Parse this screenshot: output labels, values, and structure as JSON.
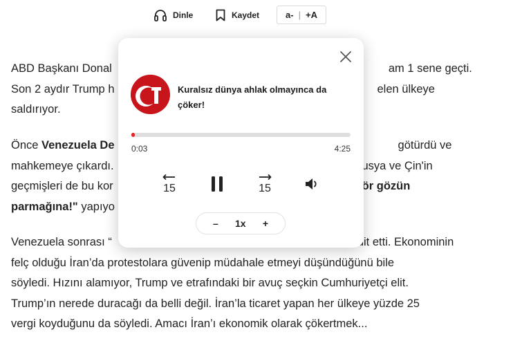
{
  "toolbar": {
    "listen_label": "Dinle",
    "save_label": "Kaydet",
    "font_decrease": "a-",
    "font_separator": "|",
    "font_increase": "+A"
  },
  "article": {
    "p1": {
      "l1_a": "ABD Başkanı Donal",
      "l1_b": "am 1 sene geçti.",
      "l2_a": "Son 2 aydır Trump h",
      "l2_b": "elen ülkeye",
      "l3": "saldırıyor."
    },
    "p2": {
      "l1_a": "Önce ",
      "l1_bold": "Venezuela De",
      "l1_b": "götürdü ve",
      "l2_a": "mahkemeye çıkardı.",
      "l2_b": "Rusya ve Çin'in",
      "l3_a": "geçmişleri de bu kor",
      "l3_bold": "ör gözün",
      "l4_bold": "parmağına!\"",
      "l4_a": " yapıyo"
    },
    "p3": {
      "l1_a": "Venezuela sonrası “",
      "l1_b": "dit etti. Ekonominin",
      "l2": "felç olduğu İran’da protestolara güvenip müdahale etmeyi düşündüğünü bile",
      "l3": "söyledi. Hızını alamıyor, Trump ve etrafındaki bir avuç seçkin Cumhuriyetçi elit.",
      "l4": "Trump’ın nerede duracağı da belli değil. İran’la ticaret yapan her ülkeye yüzde 25",
      "l5": "vergi koyduğunu da söyledi. Amacı İran’ı ekonomik olarak çökertmek..."
    }
  },
  "player": {
    "title": "Kuralsız dünya ahlak olmayınca da çöker!",
    "current_time": "0:03",
    "duration": "4:25",
    "progress_fraction": 0.012,
    "skip_seconds": "15",
    "speed_minus": "–",
    "speed_value": "1x",
    "speed_plus": "+",
    "thumbnail_letter": "T",
    "accent_color": "#e3262b"
  },
  "icons": {
    "listen": "headphones-icon",
    "save": "bookmark-icon",
    "close": "close-icon",
    "rewind": "rewind-15-icon",
    "pause": "pause-icon",
    "forward": "forward-15-icon",
    "volume": "volume-icon"
  }
}
